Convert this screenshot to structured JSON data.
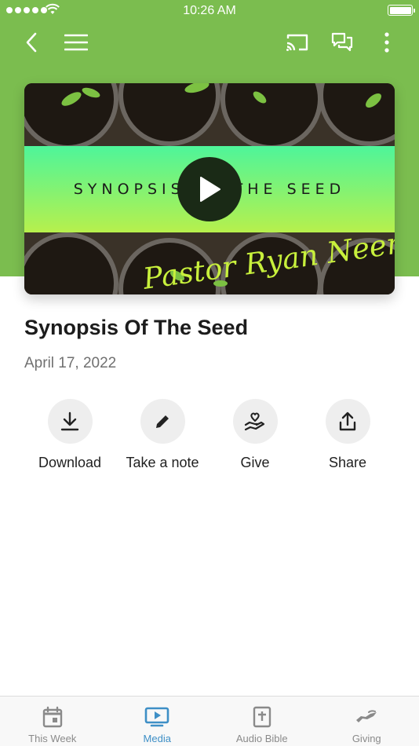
{
  "status_bar": {
    "time": "10:26 AM"
  },
  "nav": {
    "back_icon": "chevron-left-icon",
    "menu_icon": "hamburger-menu-icon",
    "cast_icon": "cast-icon",
    "chat_icon": "chat-bubbles-icon",
    "more_icon": "more-vertical-icon"
  },
  "media": {
    "thumbnail_title": "SYNOPSIS OF THE SEED",
    "thumbnail_signature": "Pastor Ryan Neer",
    "title": "Synopsis Of The Seed",
    "date": "April 17, 2022"
  },
  "actions": [
    {
      "label": "Download",
      "icon": "download-icon"
    },
    {
      "label": "Take a note",
      "icon": "pencil-icon"
    },
    {
      "label": "Give",
      "icon": "heart-hand-icon"
    },
    {
      "label": "Share",
      "icon": "share-icon"
    }
  ],
  "tabs": [
    {
      "label": "This Week",
      "icon": "calendar-icon",
      "active": false
    },
    {
      "label": "Media",
      "icon": "tv-play-icon",
      "active": true
    },
    {
      "label": "Audio Bible",
      "icon": "bible-icon",
      "active": false
    },
    {
      "label": "Giving",
      "icon": "giving-hand-icon",
      "active": false
    }
  ],
  "colors": {
    "header_green": "#7bbd4f",
    "active_tab": "#3e8fc6",
    "inactive_tab": "#8a8a8a",
    "band_gradient_top": "#4ef59a",
    "band_gradient_bottom": "#b7f04c"
  }
}
